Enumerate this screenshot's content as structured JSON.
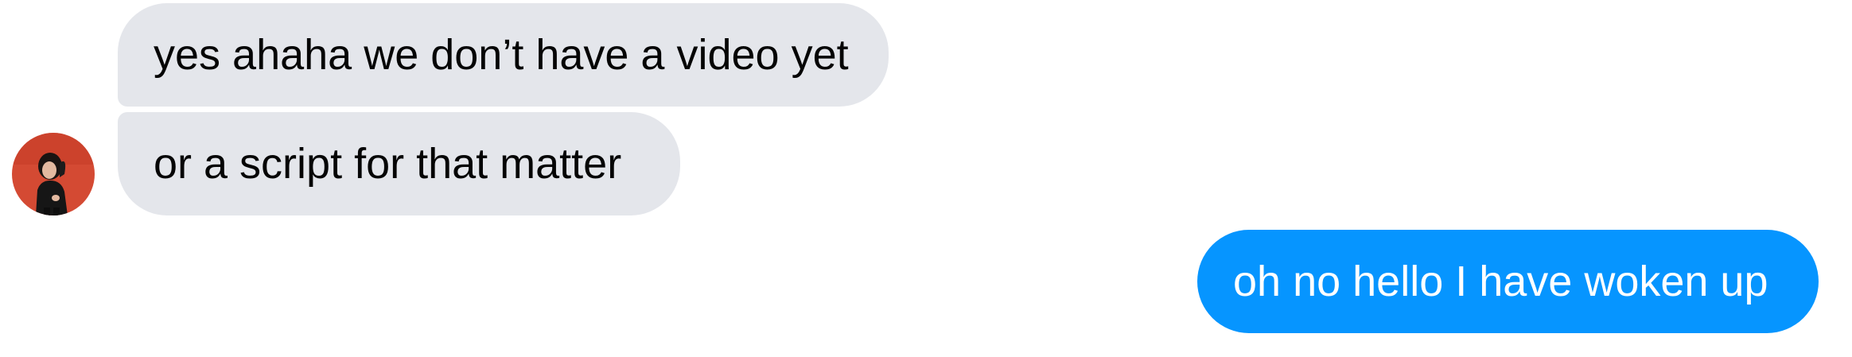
{
  "conversation": {
    "messages": [
      {
        "sender": "other",
        "text": "yes ahaha we don’t have a video yet"
      },
      {
        "sender": "other",
        "text": "or a script for that matter"
      },
      {
        "sender": "self",
        "text": "oh no hello I have woken up"
      }
    ],
    "contact_avatar": {
      "icon": "profile-photo-icon",
      "background_color": "#d44a33"
    },
    "colors": {
      "incoming_bubble": "#e4e6eb",
      "incoming_text": "#050505",
      "outgoing_bubble": "#0695ff",
      "outgoing_text": "#ffffff"
    }
  }
}
